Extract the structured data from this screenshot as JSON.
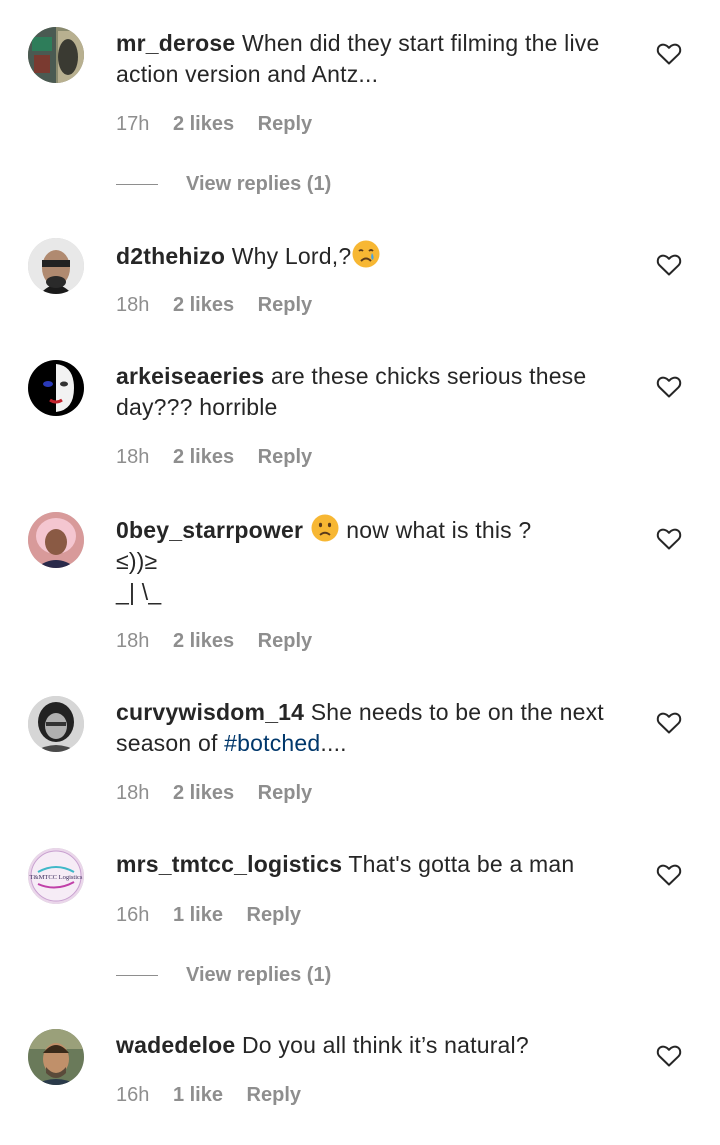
{
  "comments": [
    {
      "username": "mr_derose",
      "text": "When did they start filming the live action version and Antz...",
      "time": "17h",
      "likes": "2 likes",
      "reply": "Reply",
      "view_replies": "View replies (1)"
    },
    {
      "username": "d2thehizo",
      "text": "Why Lord,?",
      "emoji": "crying-face",
      "time": "18h",
      "likes": "2 likes",
      "reply": "Reply"
    },
    {
      "username": "arkeiseaeries",
      "text": "are these chicks serious these day??? horrible",
      "time": "18h",
      "likes": "2 likes",
      "reply": "Reply"
    },
    {
      "username": "0bey_starrpower",
      "emoji": "frowning-face",
      "text": "now what is this ?",
      "text_line2": "≤))≥",
      "text_line3": "_| \\_",
      "time": "18h",
      "likes": "2 likes",
      "reply": "Reply"
    },
    {
      "username": "curvywisdom_14",
      "text": "She needs to be on the next season of",
      "hashtag": "#botched",
      "text_end": "....",
      "time": "18h",
      "likes": "2 likes",
      "reply": "Reply"
    },
    {
      "username": "mrs_tmtcc_logistics",
      "text": "That's gotta be a man",
      "time": "16h",
      "likes": "1 like",
      "reply": "Reply",
      "view_replies": "View replies (1)",
      "avatar_logo": "T&MTCC Logistics"
    },
    {
      "username": "wadedeloe",
      "text": "Do you all think it’s natural?",
      "time": "16h",
      "likes": "1 like",
      "reply": "Reply"
    }
  ],
  "colors": {
    "text": "#262626",
    "muted": "#8e8e8e",
    "hashtag": "#00376b"
  }
}
